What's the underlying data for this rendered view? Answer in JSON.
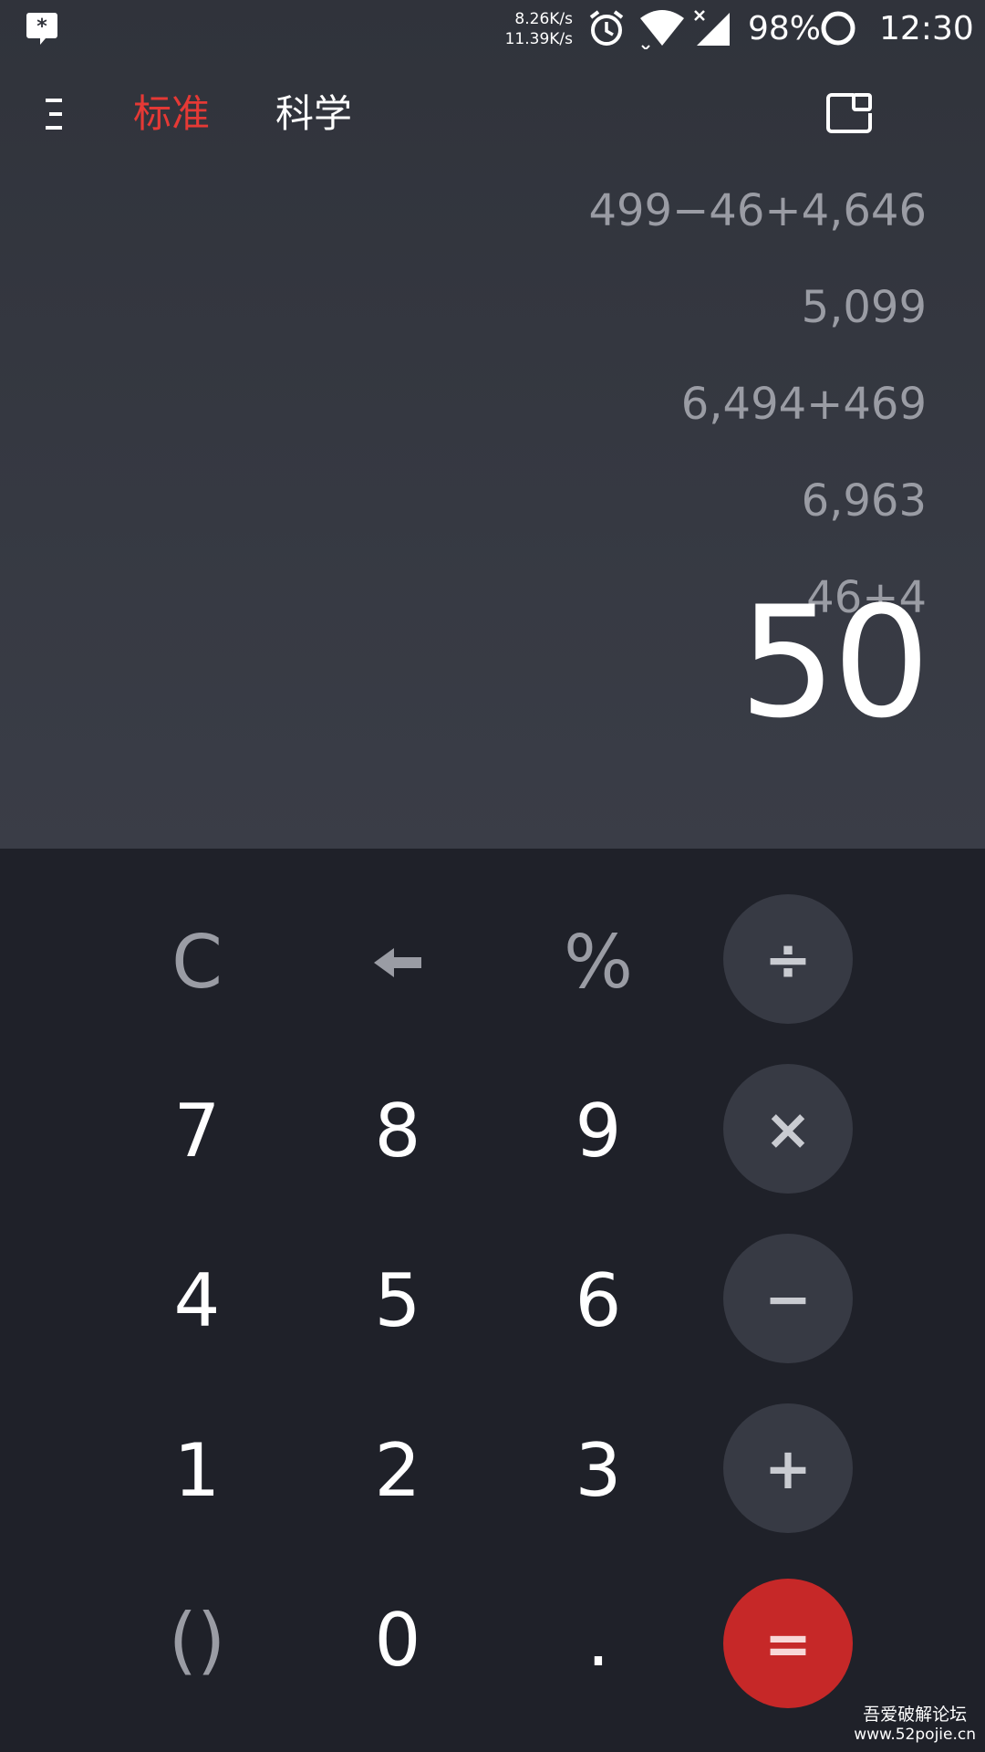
{
  "status_bar": {
    "net_down": "8.26K/s",
    "net_up": "11.39K/s",
    "battery": "98%",
    "time": "12:30",
    "icons": [
      "app-icon",
      "alarm-icon",
      "wifi-icon",
      "signal-icon",
      "battery-ring-icon"
    ]
  },
  "app_bar": {
    "tabs": [
      {
        "label": "标准",
        "active": true
      },
      {
        "label": "科学",
        "active": false
      }
    ],
    "accent_color": "#e53935"
  },
  "history": [
    "499−46+4,646",
    "5,099",
    "6,494+469",
    "6,963",
    "46+4"
  ],
  "result": "50",
  "keypad": {
    "rows": [
      [
        "C",
        "←",
        "%",
        "÷"
      ],
      [
        "7",
        "8",
        "9",
        "×"
      ],
      [
        "4",
        "5",
        "6",
        "−"
      ],
      [
        "1",
        "2",
        "3",
        "+"
      ],
      [
        "()",
        "0",
        ".",
        "="
      ]
    ],
    "equals_color": "#c62828"
  },
  "watermark": {
    "title": "吾爱破解论坛",
    "url": "www.52pojie.cn"
  }
}
